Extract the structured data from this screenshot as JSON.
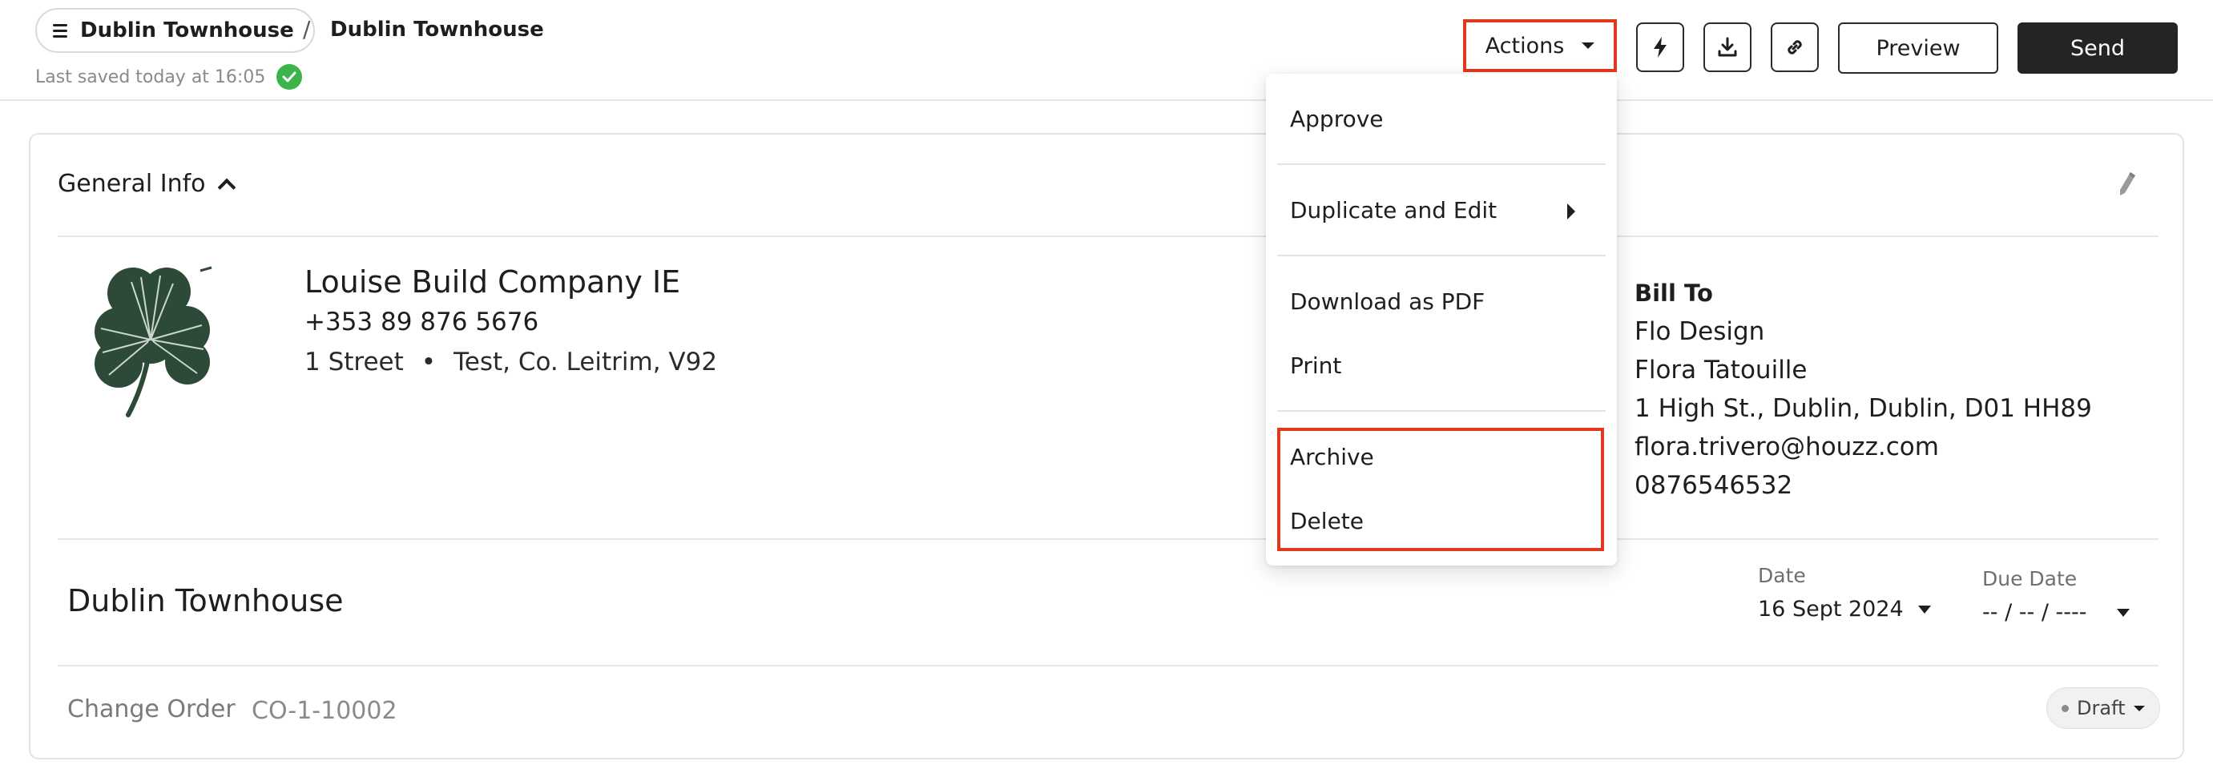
{
  "header": {
    "breadcrumb_root": "Dublin Townhouse",
    "breadcrumb_sep": "/",
    "breadcrumb_current": "Dublin Townhouse",
    "last_saved": "Last saved today at 16:05",
    "actions_label": "Actions",
    "preview_label": "Preview",
    "send_label": "Send",
    "icons": [
      "lightning-icon",
      "download-icon",
      "link-icon"
    ]
  },
  "general_info": {
    "title": "General Info"
  },
  "company": {
    "name": "Louise Build Company IE",
    "phone": "+353 89 876 5676",
    "street": "1 Street",
    "bullet": "•",
    "city": "Test, Co. Leitrim, V92"
  },
  "bill_to": {
    "title": "Bill To",
    "lines": [
      "Flo Design",
      "Flora Tatouille",
      "1 High St., Dublin, Dublin, D01 HH89",
      "flora.trivero@houzz.com",
      "0876546532"
    ]
  },
  "document": {
    "title": "Dublin Townhouse",
    "date_label": "Date",
    "date_value": "16 Sept 2024",
    "due_label": "Due Date",
    "due_value": "-- / -- / ----",
    "type_label": "Change Order",
    "number": "CO-1-10002",
    "status": "Draft"
  },
  "actions_menu": {
    "items": [
      "Approve",
      "Duplicate and Edit",
      "Download as PDF",
      "Print",
      "Archive",
      "Delete"
    ]
  },
  "colors": {
    "highlight": "#e03a1e",
    "send_bg": "#242424",
    "check_green": "#3bb54a",
    "logo_green": "#2d4a38"
  }
}
